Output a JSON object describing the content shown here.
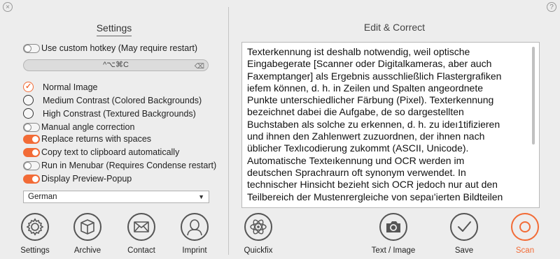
{
  "window": {
    "close_glyph": "×",
    "help_glyph": "?"
  },
  "settings": {
    "title": "Settings",
    "options": [
      {
        "label": "Use custom hotkey (May require restart)",
        "type": "toggle",
        "on": false
      },
      {
        "label": "Normal Image",
        "type": "radio",
        "selected": true
      },
      {
        "label": "Medium Contrast (Colored Backgrounds)",
        "type": "radio",
        "selected": false
      },
      {
        "label": "High Constrast (Textured Backgrounds)",
        "type": "radio",
        "selected": false
      },
      {
        "label": "Manual angle correction",
        "type": "toggle",
        "on": false
      },
      {
        "label": "Replace returns with spaces",
        "type": "toggle",
        "on": true
      },
      {
        "label": "Copy text to clipboard automatically",
        "type": "toggle",
        "on": true
      },
      {
        "label": "Run in Menubar (Requires Condense restart)",
        "type": "toggle",
        "on": false
      },
      {
        "label": "Display Preview-Popup",
        "type": "toggle",
        "on": true
      }
    ],
    "hotkey_value": "^⌥⌘C",
    "hotkey_clear_glyph": "⌫",
    "language_select": "German"
  },
  "left_toolbar": [
    {
      "label": "Settings",
      "icon": "gear-icon"
    },
    {
      "label": "Archive",
      "icon": "box-icon"
    },
    {
      "label": "Contact",
      "icon": "envelope-icon"
    },
    {
      "label": "Imprint",
      "icon": "person-icon"
    }
  ],
  "editor": {
    "title": "Edit & Correct",
    "text": "Texterkennung ist deshalb notwendig, weil optische\nEingabegerate [Scanner oder Digitalkameras, aber auch\nFaxemptanger] als Ergebnis ausschließlich Flastergrafiken\niefem können, d. h. in Zeilen und Spalten angeordnete\nPunkte unterschiedlicher Färbung (Pixel). Texterkennung\nbezeichnet dabei die Aufgabe, de so dargestellten\nBuchstaben als solche zu erkennen, d. h. zu ideı1tifizieren\nund ihnen den Zahlenwert zuzuordnen, der ihnen nach\nüblicher Texlıcodierung zukommt (ASCII, Unicode).\nAutomatische Texteıkennung und OCR werden im\ndeutschen Sprachraurn oft synonym verwendet. In\ntechnischer Hinsicht bezieht sich OCR jedoch nur aut den\nTeilbereich der Mustenrergleiche von sepaı'ierten Bildteilen"
  },
  "right_toolbar": {
    "quickfix": {
      "label": "Quickfix",
      "icon": "atom-icon"
    },
    "text_image": {
      "label": "Text / Image",
      "icon": "camera-icon"
    },
    "save": {
      "label": "Save",
      "icon": "checkmark-icon"
    },
    "scan": {
      "label": "Scan",
      "icon": "scan-icon"
    }
  },
  "colors": {
    "accent": "#f26b36"
  }
}
